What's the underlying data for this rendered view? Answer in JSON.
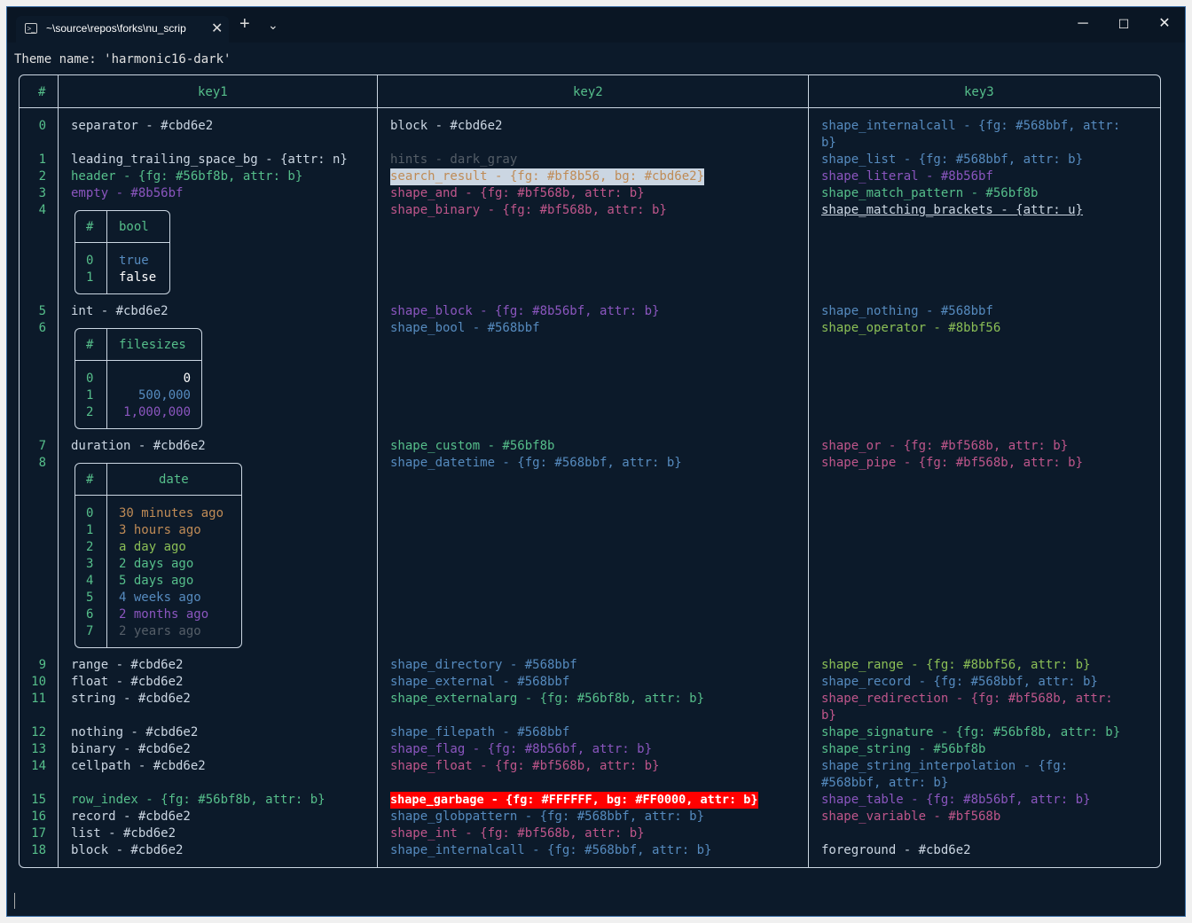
{
  "window": {
    "tab_title": "~\\source\\repos\\forks\\nu_scrip",
    "new_tab": "+",
    "dropdown": "⌄",
    "minimize": "─",
    "maximize": "☐",
    "close": "✕",
    "tab_close": "✕",
    "tab_icon": "powershell-icon",
    "tab_icon_glyph": ">_"
  },
  "terminal": {
    "theme_line": "Theme name: 'harmonic16-dark'",
    "colors": {
      "background": "#0c1a2a",
      "foreground": "#cbd6e2"
    }
  },
  "table": {
    "headers": [
      "#",
      "key1",
      "key2",
      "key3"
    ],
    "rows": [
      {
        "i": "0",
        "k1": "separator - #cbd6e2",
        "k2": "block - #cbd6e2",
        "k3": "shape_internalcall - {fg: #568bbf, attr:",
        "k3b": "b}"
      },
      {
        "i": "1",
        "k1": "leading_trailing_space_bg - {attr: n}",
        "k2": "hints - dark_gray",
        "k3": "shape_list - {fg: #568bbf, attr: b}"
      },
      {
        "i": "2",
        "k1": "header - {fg: #56bf8b, attr: b}",
        "k2": "search_result - {fg: #bf8b56, bg: #cbd6e2}",
        "k3": "shape_literal - #8b56bf"
      },
      {
        "i": "3",
        "k1": "empty - #8b56bf",
        "k2": "shape_and - {fg: #bf568b, attr: b}",
        "k3": "shape_match_pattern - #56bf8b"
      },
      {
        "i": "4",
        "k1": "",
        "k2": "shape_binary - {fg: #bf568b, attr: b}",
        "k3": "shape_matching_brackets - {attr: u}"
      },
      {
        "i": "5",
        "k1": "int - #cbd6e2",
        "k2": "shape_block - {fg: #8b56bf, attr: b}",
        "k3": "shape_nothing - #568bbf"
      },
      {
        "i": "6",
        "k1": "",
        "k2": "shape_bool - #568bbf",
        "k3": "shape_operator - #8bbf56"
      },
      {
        "i": "7",
        "k1": "duration - #cbd6e2",
        "k2": "shape_custom - #56bf8b",
        "k3": "shape_or - {fg: #bf568b, attr: b}"
      },
      {
        "i": "8",
        "k1": "",
        "k2": "shape_datetime - {fg: #568bbf, attr: b}",
        "k3": "shape_pipe - {fg: #bf568b, attr: b}"
      },
      {
        "i": "9",
        "k1": "range - #cbd6e2",
        "k2": "shape_directory - #568bbf",
        "k3": "shape_range - {fg: #8bbf56, attr: b}"
      },
      {
        "i": "10",
        "k1": "float - #cbd6e2",
        "k2": "shape_external - #568bbf",
        "k3": "shape_record - {fg: #568bbf, attr: b}"
      },
      {
        "i": "11",
        "k1": "string - #cbd6e2",
        "k2": "shape_externalarg - {fg: #56bf8b, attr: b}",
        "k3": "shape_redirection - {fg: #bf568b, attr:",
        "k3b": "b}"
      },
      {
        "i": "12",
        "k1": "nothing - #cbd6e2",
        "k2": "shape_filepath - #568bbf",
        "k3": "shape_signature - {fg: #56bf8b, attr: b}"
      },
      {
        "i": "13",
        "k1": "binary - #cbd6e2",
        "k2": "shape_flag - {fg: #8b56bf, attr: b}",
        "k3": "shape_string - #56bf8b"
      },
      {
        "i": "14",
        "k1": "cellpath - #cbd6e2",
        "k2": "shape_float - {fg: #bf568b, attr: b}",
        "k3": "shape_string_interpolation - {fg:",
        "k3b": "#568bbf, attr: b}"
      },
      {
        "i": "15",
        "k1": "row_index - {fg: #56bf8b, attr: b}",
        "k2": "shape_garbage - {fg: #FFFFFF, bg: #FF0000, attr: b}",
        "k3": "shape_table - {fg: #8b56bf, attr: b}"
      },
      {
        "i": "16",
        "k1": "record - #cbd6e2",
        "k2": "shape_globpattern - {fg: #568bbf, attr: b}",
        "k3": "shape_variable - #bf568b"
      },
      {
        "i": "17",
        "k1": "list - #cbd6e2",
        "k2": "shape_int - {fg: #bf568b, attr: b}",
        "k3": ""
      },
      {
        "i": "18",
        "k1": "block - #cbd6e2",
        "k2": "shape_internalcall - {fg: #568bbf, attr: b}",
        "k3": "foreground - #cbd6e2"
      }
    ]
  },
  "nested_bool": {
    "headers": [
      "#",
      "bool"
    ],
    "rows": [
      {
        "i": "0",
        "v": "true"
      },
      {
        "i": "1",
        "v": "false"
      }
    ]
  },
  "nested_filesizes": {
    "headers": [
      "#",
      "filesizes"
    ],
    "rows": [
      {
        "i": "0",
        "v": "0"
      },
      {
        "i": "1",
        "v": "500,000"
      },
      {
        "i": "2",
        "v": "1,000,000"
      }
    ]
  },
  "nested_date": {
    "headers": [
      "#",
      "date"
    ],
    "rows": [
      {
        "i": "0",
        "v": "30 minutes ago"
      },
      {
        "i": "1",
        "v": "3 hours ago"
      },
      {
        "i": "2",
        "v": "a day ago"
      },
      {
        "i": "3",
        "v": "2 days ago"
      },
      {
        "i": "4",
        "v": "5 days ago"
      },
      {
        "i": "5",
        "v": "4 weeks ago"
      },
      {
        "i": "6",
        "v": "2 months ago"
      },
      {
        "i": "7",
        "v": "2 years ago"
      }
    ]
  }
}
